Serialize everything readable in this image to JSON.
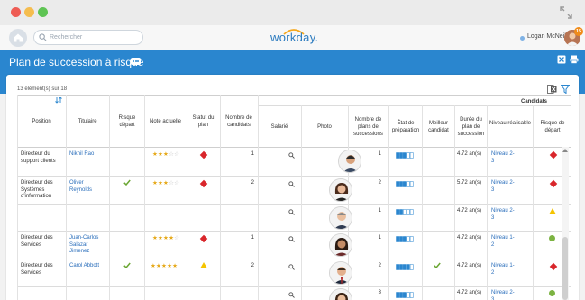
{
  "window": {
    "colors": {
      "close": "#ee5c54",
      "minimize": "#f5bd4f",
      "maximize": "#5fc454"
    }
  },
  "topnav": {
    "search_placeholder": "Rechercher",
    "logo": "workday.",
    "user_name": "Logan McNeil",
    "notification_count": "15"
  },
  "header": {
    "title": "Plan de succession à risque"
  },
  "table": {
    "count_text": "13 élément(s) sur 18",
    "candidates_group": "Candidats",
    "columns": {
      "position": "Position",
      "holder": "Titulaire",
      "departure_risk": "Risque départ",
      "rating": "Note actuelle",
      "plan_status": "Statut du plan",
      "candidate_count": "Nombre de candidats",
      "employee": "Salarié",
      "photo": "Photo",
      "succession_plans": "Nombre de plans de successions",
      "readiness": "État de préparation",
      "best_candidate": "Meilleur candidat",
      "plan_duration": "Durée du plan de succession",
      "level": "Niveau réalisable",
      "cand_departure_risk": "Risque de départ"
    },
    "rows": [
      {
        "position": "Directeur du support clients",
        "holder": "Nikhil Rao",
        "risk": "",
        "stars": 3,
        "status": "red-diamond",
        "count": "1",
        "plans": "1",
        "prep": 3,
        "best": "",
        "duration": "4.72 an(s)",
        "level": "Niveau 2-3",
        "cand_risk": "red-diamond"
      },
      {
        "position": "Directeur des Systèmes d'information",
        "holder": "Oliver Reynolds",
        "risk": "check",
        "stars": 3,
        "status": "red-diamond",
        "count": "2",
        "plans": "2",
        "prep": 3,
        "best": "",
        "duration": "5.72 an(s)",
        "level": "Niveau 2-3",
        "cand_risk": "red-diamond"
      },
      {
        "position": "",
        "holder": "",
        "risk": "",
        "stars": 0,
        "status": "",
        "count": "",
        "plans": "1",
        "prep": 2,
        "best": "",
        "duration": "4.72 an(s)",
        "level": "Niveau 2-3",
        "cand_risk": "warning"
      },
      {
        "position": "Directeur des Services",
        "holder": "Juan-Carlos Salazar Jimenez",
        "risk": "",
        "stars": 4,
        "status": "red-diamond",
        "count": "1",
        "plans": "1",
        "prep": 3,
        "best": "",
        "duration": "4.72 an(s)",
        "level": "Niveau 1-2",
        "cand_risk": "green-circle"
      },
      {
        "position": "Directeur des Services",
        "holder": "Carol Abbott",
        "risk": "check",
        "stars": 5,
        "status": "warning",
        "count": "2",
        "plans": "2",
        "prep": 4,
        "best": "check",
        "duration": "4.72 an(s)",
        "level": "Niveau 1-2",
        "cand_risk": "red-diamond"
      },
      {
        "position": "",
        "holder": "",
        "risk": "",
        "stars": 0,
        "status": "",
        "count": "",
        "plans": "3",
        "prep": 3,
        "best": "",
        "duration": "4.72 an(s)",
        "level": "Niveau 2-3",
        "cand_risk": "green-circle"
      }
    ]
  },
  "colors": {
    "accent": "#2a86cf",
    "link": "#2a6ebb",
    "red": "#d9262b",
    "amber": "#f5c400",
    "green": "#7cb342",
    "star": "#e6a817"
  },
  "icons": [
    "home-icon",
    "search-icon",
    "expand-icon",
    "more-icon",
    "excel-icon",
    "print-icon",
    "filter-icon",
    "sort-icon",
    "magnifier-icon",
    "check-icon",
    "warning-icon",
    "diamond-icon"
  ]
}
